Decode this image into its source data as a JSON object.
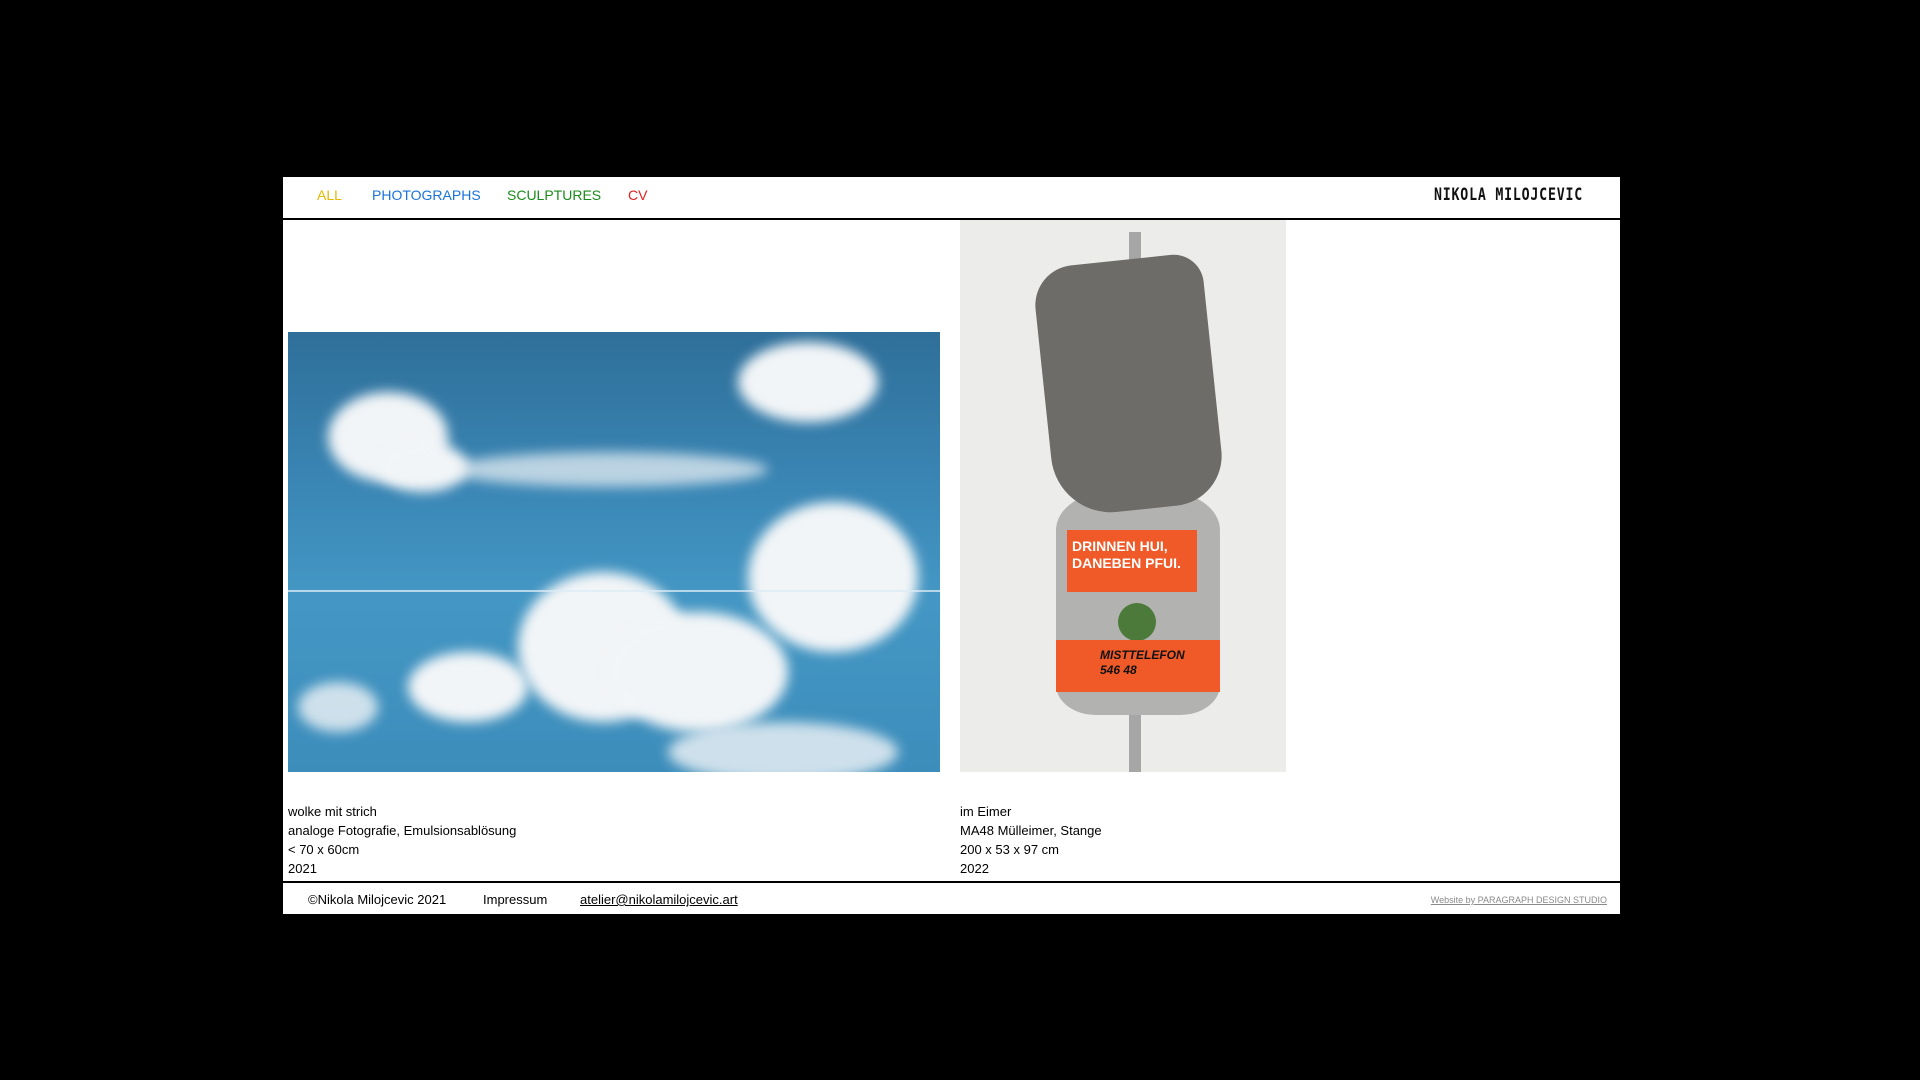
{
  "nav": {
    "items": [
      {
        "label": "ALL",
        "color": "#e6b800"
      },
      {
        "label": "PHOTOGRAPHS",
        "color": "#1a73d9"
      },
      {
        "label": "SCULPTURES",
        "color": "#1a8a1a"
      },
      {
        "label": "CV",
        "color": "#e02020"
      }
    ]
  },
  "brand": {
    "name": "NIKOLA MILOJCEVIC"
  },
  "works": [
    {
      "title": "wolke mit strich",
      "medium": "analoge Fotografie, Emulsionsablösung",
      "size": "< 70 x 60cm",
      "year": "2021"
    },
    {
      "title": "im Eimer",
      "medium": "MA48 Mülleimer, Stange",
      "size": "200 x 53 x 97 cm",
      "year": "2022",
      "image_text": {
        "line1": "DRINNEN HUI,",
        "line2": "DANEBEN PFUI.",
        "line3": "MISTTELEFON",
        "line4": "546 48"
      }
    }
  ],
  "footer": {
    "copyright": "©Nikola Milojcevic 2021",
    "impressum": "Impressum",
    "email": "atelier@nikolamilojcevic.art",
    "credit": "Website by PARAGRAPH DESIGN STUDIO"
  }
}
